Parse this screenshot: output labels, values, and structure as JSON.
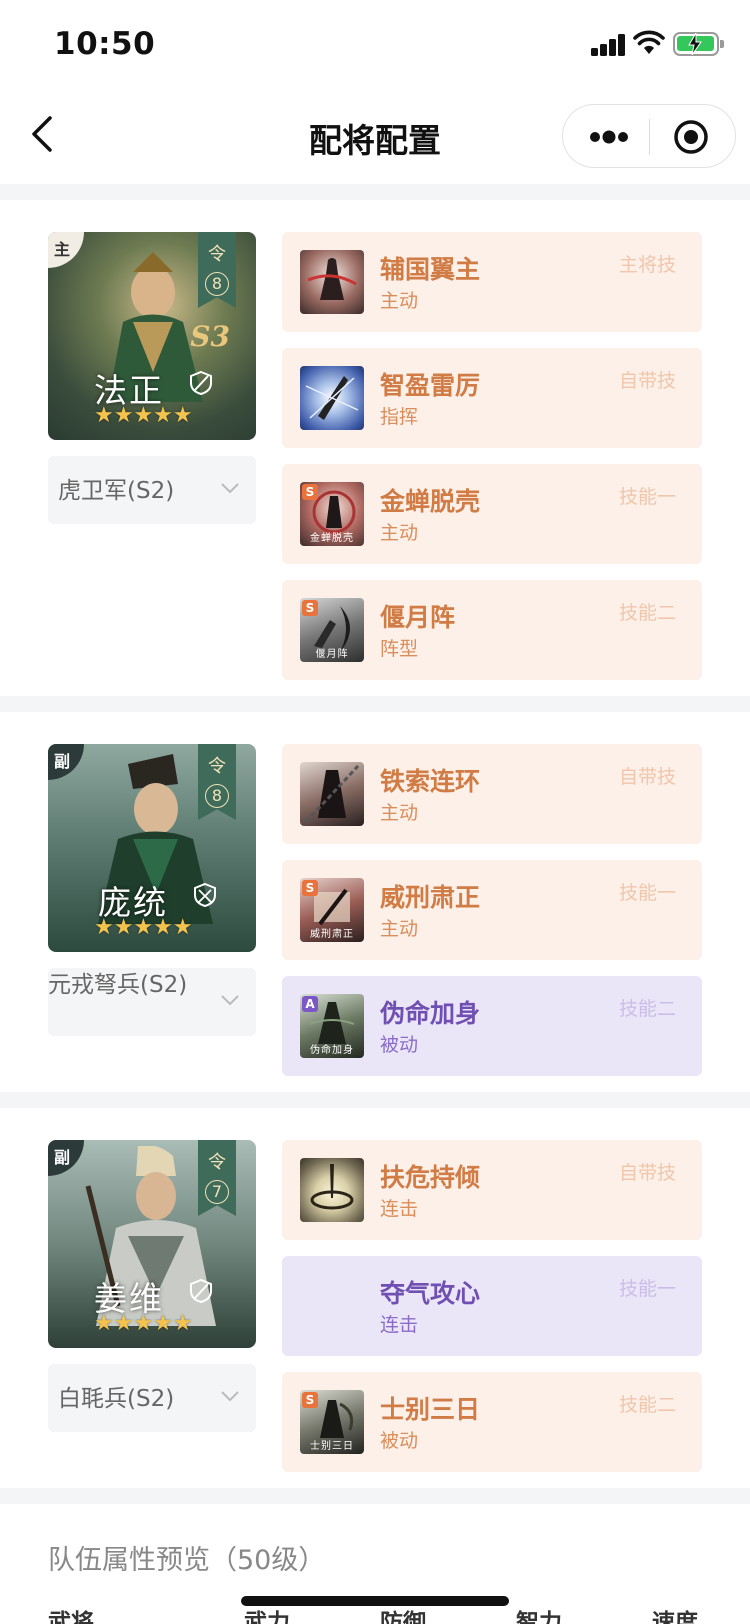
{
  "status_bar": {
    "time": "10:50"
  },
  "nav": {
    "title": "配将配置"
  },
  "generals": [
    {
      "role": "主",
      "command_label": "令",
      "command_cost": "8",
      "season_mark": "S3",
      "name": "法正",
      "stars": "★★★★★",
      "troop": "虎卫军(S2)",
      "skills": [
        {
          "grade": "",
          "caption": "",
          "name": "辅国翼主",
          "type": "主动",
          "slot": "主将技",
          "style": "orange"
        },
        {
          "grade": "",
          "caption": "",
          "name": "智盈雷厉",
          "type": "指挥",
          "slot": "自带技",
          "style": "orange"
        },
        {
          "grade": "S",
          "caption": "金蝉脱壳",
          "name": "金蝉脱壳",
          "type": "主动",
          "slot": "技能一",
          "style": "orange"
        },
        {
          "grade": "S",
          "caption": "偃月阵",
          "name": "偃月阵",
          "type": "阵型",
          "slot": "技能二",
          "style": "orange"
        }
      ]
    },
    {
      "role": "副",
      "command_label": "令",
      "command_cost": "8",
      "season_mark": "",
      "name": "庞统",
      "stars": "★★★★★",
      "troop": "元戎弩兵(S2)",
      "skills": [
        {
          "grade": "",
          "caption": "",
          "name": "铁索连环",
          "type": "主动",
          "slot": "自带技",
          "style": "orange"
        },
        {
          "grade": "S",
          "caption": "威刑肃正",
          "name": "威刑肃正",
          "type": "主动",
          "slot": "技能一",
          "style": "orange"
        },
        {
          "grade": "A",
          "caption": "伪命加身",
          "name": "伪命加身",
          "type": "被动",
          "slot": "技能二",
          "style": "purple"
        }
      ]
    },
    {
      "role": "副",
      "command_label": "令",
      "command_cost": "7",
      "season_mark": "",
      "name": "姜维",
      "stars": "★★★★★",
      "troop": "白毦兵(S2)",
      "skills": [
        {
          "grade": "",
          "caption": "",
          "name": "扶危持倾",
          "type": "连击",
          "slot": "自带技",
          "style": "orange"
        },
        {
          "grade": "",
          "caption": "",
          "name": "夺气攻心",
          "type": "连击",
          "slot": "技能一",
          "style": "purple"
        },
        {
          "grade": "S",
          "caption": "士别三日",
          "name": "士别三日",
          "type": "被动",
          "slot": "技能二",
          "style": "orange"
        }
      ]
    }
  ],
  "preview": {
    "title": "队伍属性预览（50级）",
    "columns": [
      "武将",
      "武力",
      "防御",
      "智力",
      "速度"
    ]
  },
  "colors": {
    "skill_orange": "#d17b45",
    "skill_purple": "#6f4fb2",
    "star": "#f3c34d"
  }
}
